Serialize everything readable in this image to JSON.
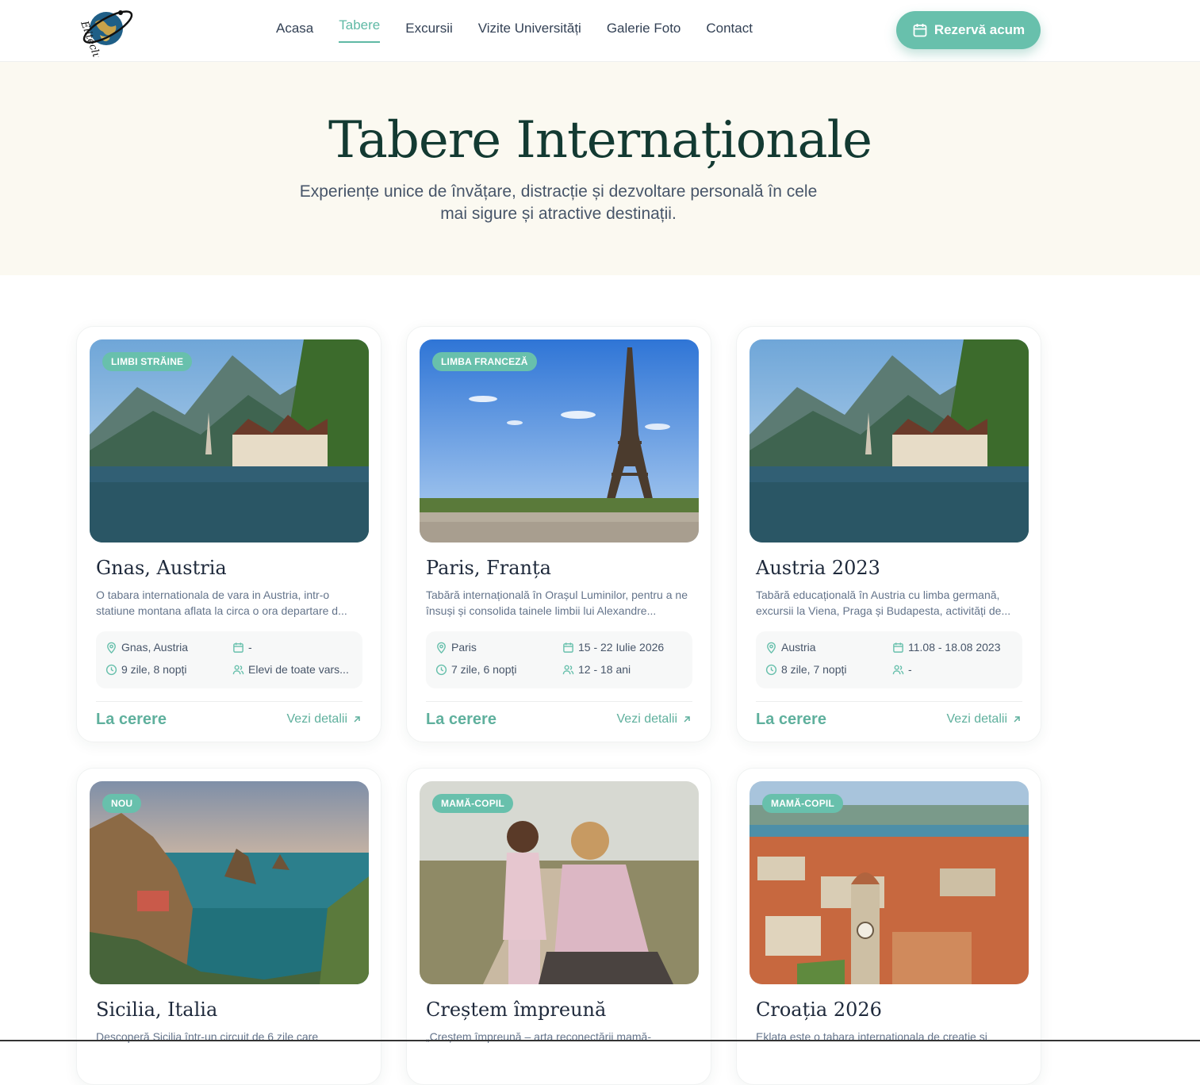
{
  "header": {
    "nav": [
      {
        "label": "Acasa"
      },
      {
        "label": "Tabere"
      },
      {
        "label": "Excursii"
      },
      {
        "label": "Vizite Universități"
      },
      {
        "label": "Galerie Foto"
      },
      {
        "label": "Contact"
      }
    ],
    "active_index": 1,
    "cta_label": "Rezervă acum"
  },
  "hero": {
    "title": "Tabere Internaționale",
    "subtitle": "Experiențe unice de învățare, distracție și dezvoltare personală în cele mai sigure și atractive destinații."
  },
  "cards": [
    {
      "badge": "LIMBI STRĂINE",
      "title": "Gnas, Austria",
      "description": "O tabara internationala de vara in Austria, intr-o statiune montana aflata la circa o ora departare d...",
      "location": "Gnas, Austria",
      "dates": "-",
      "duration": "9 zile, 8 nopți",
      "age": "Elevi de toate vars...",
      "price": "La cerere",
      "details_label": "Vezi detalii"
    },
    {
      "badge": "LIMBA FRANCEZĂ",
      "title": "Paris, Franța",
      "description": "Tabără internațională în Orașul Luminilor, pentru a ne însuși și consolida tainele limbii lui Alexandre...",
      "location": "Paris",
      "dates": "15 - 22 Iulie 2026",
      "duration": "7 zile, 6 nopți",
      "age": "12 - 18 ani",
      "price": "La cerere",
      "details_label": "Vezi detalii"
    },
    {
      "badge": "",
      "title": "Austria 2023",
      "description": "Tabără educațională în Austria cu limba germană, excursii la Viena, Praga și Budapesta, activități de...",
      "location": "Austria",
      "dates": "11.08 - 18.08 2023",
      "duration": "8 zile, 7 nopți",
      "age": "-",
      "price": "La cerere",
      "details_label": "Vezi detalii"
    },
    {
      "badge": "NOU",
      "title": "Sicilia, Italia",
      "description": "Descoperă Sicilia într-un circuit de 6 zile care"
    },
    {
      "badge": "MAMĂ-COPIL",
      "title": "Creștem împreună",
      "description": "„Creștem împreună – arta reconectării mamă-"
    },
    {
      "badge": "MAMĂ-COPIL",
      "title": "Croația 2026",
      "description": "Eklata este o tabara internationala de creatie si"
    }
  ],
  "colors": {
    "accent": "#68c0ac",
    "hero_bg": "#fbf9f1",
    "title": "#133a32"
  }
}
